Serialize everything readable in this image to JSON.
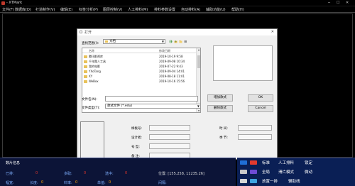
{
  "window": {
    "title": "- XTMark"
  },
  "menu": [
    "文件(F)",
    "数据库(D)",
    "打造制作(V)",
    "编辑(E)",
    "标签分析(P)",
    "图层控制(V)",
    "人工排料(M)",
    "排料参数设置",
    "自动排料(A)",
    "辅助功能(U)",
    "帮助(H)"
  ],
  "dialog": {
    "title": "打开",
    "lookin_label": "查找范围(I):",
    "lookin_value": "文档",
    "columns": {
      "name": "名称",
      "date": "修改日期"
    },
    "files": [
      {
        "name": "腾讯影视库",
        "date": "2019-10-19 9:58"
      },
      {
        "name": "千年舞人工具",
        "date": "2019-09-08 10:34"
      },
      {
        "name": "我的电影",
        "date": "2019-07-22 9:43"
      },
      {
        "name": "YXoTang",
        "date": "2019-09-04 14:01"
      },
      {
        "name": "XY",
        "date": "2019-08-18 11:01"
      },
      {
        "name": "WeBox",
        "date": "2019-10-16 15:56"
      }
    ],
    "filename_label": "文件名(N):",
    "filename_value": "",
    "filetype_label": "文件类型(T):",
    "filetype_value": "款式文件 (*.edu)",
    "ok": "OK",
    "cancel": "Cancel",
    "add_style": "增加款式",
    "delete_style": "删除款式",
    "info": {
      "style_no": "样板号:",
      "designer": "设计者:",
      "size": "号    型:",
      "note": "备    注:",
      "time": "时    间:",
      "season": "季    节:"
    }
  },
  "status": {
    "title": "数片信息",
    "placed_label": "已排:",
    "placed_value": "0",
    "more_label": "多取:",
    "more_value": "0",
    "selected_label": "选中:",
    "selected_value": "0",
    "position": "位置: [155.258, 11235.26]",
    "width_label": "幅宽:",
    "length_label": "长度:",
    "length_value": "0",
    "rate_label": "料率:",
    "rate_value": "0",
    "density_label": "单值:",
    "density_value": "0",
    "gap_label": "间隔:"
  },
  "right_panel": {
    "row1": [
      "标准",
      "人工排料",
      "锁定"
    ],
    "row2": [
      "全局",
      "滑片模式",
      "微动"
    ],
    "row3": [
      "放置一排",
      "辅助线"
    ]
  },
  "colors": {
    "panel_bg": "#0c1437",
    "panel_right_bg": "#0a1f55",
    "red_value": "#e0352b",
    "orange_value": "#ffa500",
    "label": "#7fb0ff"
  }
}
